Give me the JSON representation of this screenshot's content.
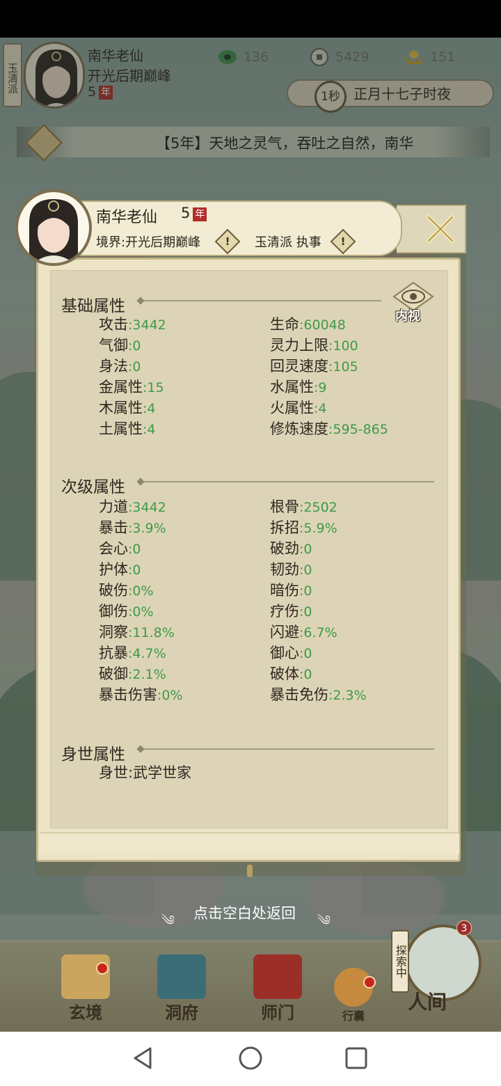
{
  "hud": {
    "sect_tag": "玉清派",
    "name": "南华老仙",
    "realm": "开光后期巅峰",
    "years": "5",
    "nian": "年",
    "resources": [
      {
        "icon": "jade-ring-icon",
        "value": "136"
      },
      {
        "icon": "coin-icon",
        "value": "5429"
      },
      {
        "icon": "ingot-icon",
        "value": "151"
      }
    ],
    "speed": "1秒",
    "time": "正月十七子时夜"
  },
  "banner": {
    "text": "【5年】天地之灵气，吞吐之自然，南华"
  },
  "panel": {
    "name": "南华老仙",
    "years": "5",
    "nian": "年",
    "realm": "境界:开光后期巅峰",
    "sect": "玉清派 执事",
    "warn_glyph": "!",
    "eye_label": "内视",
    "sections": {
      "basic": {
        "title": "基础属性",
        "left": [
          {
            "label": "攻击",
            "value": ":3442"
          },
          {
            "label": "气御",
            "value": ":0"
          },
          {
            "label": "身法",
            "value": ":0"
          },
          {
            "label": "金属性",
            "value": ":15"
          },
          {
            "label": "木属性",
            "value": ":4"
          },
          {
            "label": "土属性",
            "value": ":4"
          }
        ],
        "right": [
          {
            "label": "生命",
            "value": ":60048"
          },
          {
            "label": "灵力上限",
            "value": ":100"
          },
          {
            "label": "回灵速度",
            "value": ":105"
          },
          {
            "label": "水属性",
            "value": ":9"
          },
          {
            "label": "火属性",
            "value": ":4"
          },
          {
            "label": "修炼速度",
            "value": ":595-865"
          }
        ]
      },
      "secondary": {
        "title": "次级属性",
        "left": [
          {
            "label": "力道",
            "value": ":3442"
          },
          {
            "label": "暴击",
            "value": ":3.9%"
          },
          {
            "label": "会心",
            "value": ":0"
          },
          {
            "label": "护体",
            "value": ":0"
          },
          {
            "label": "破伤",
            "value": ":0%"
          },
          {
            "label": "御伤",
            "value": ":0%"
          },
          {
            "label": "洞察",
            "value": ":11.8%"
          },
          {
            "label": "抗暴",
            "value": ":4.7%"
          },
          {
            "label": "破御",
            "value": ":2.1%"
          },
          {
            "label": "暴击伤害",
            "value": ":0%"
          }
        ],
        "right": [
          {
            "label": "根骨",
            "value": ":2502"
          },
          {
            "label": "拆招",
            "value": ":5.9%"
          },
          {
            "label": "破劲",
            "value": ":0"
          },
          {
            "label": "韧劲",
            "value": ":0"
          },
          {
            "label": "暗伤",
            "value": ":0"
          },
          {
            "label": "疗伤",
            "value": ":0"
          },
          {
            "label": "闪避",
            "value": ":6.7%"
          },
          {
            "label": "御心",
            "value": ":0"
          },
          {
            "label": "破体",
            "value": ":0"
          },
          {
            "label": "暴击免伤",
            "value": ":2.3%"
          }
        ]
      },
      "background": {
        "title": "身世属性",
        "items": [
          {
            "label": "身世",
            "value": ":武学世家"
          }
        ]
      }
    }
  },
  "return_hint": "点击空白处返回",
  "nav": {
    "items": [
      {
        "key": "xuanjing",
        "label": "玄境"
      },
      {
        "key": "dongfu",
        "label": "洞府"
      },
      {
        "key": "shimen",
        "label": "师门"
      },
      {
        "key": "xingnang",
        "label": "行囊"
      },
      {
        "key": "renjian",
        "label": "人间"
      }
    ],
    "explore_label": "探索中",
    "explore_badge": "3"
  },
  "colors": {
    "value_green": "#3e9a48",
    "nian_red": "#b22e2a",
    "panel_bg": "#ece4c5"
  }
}
